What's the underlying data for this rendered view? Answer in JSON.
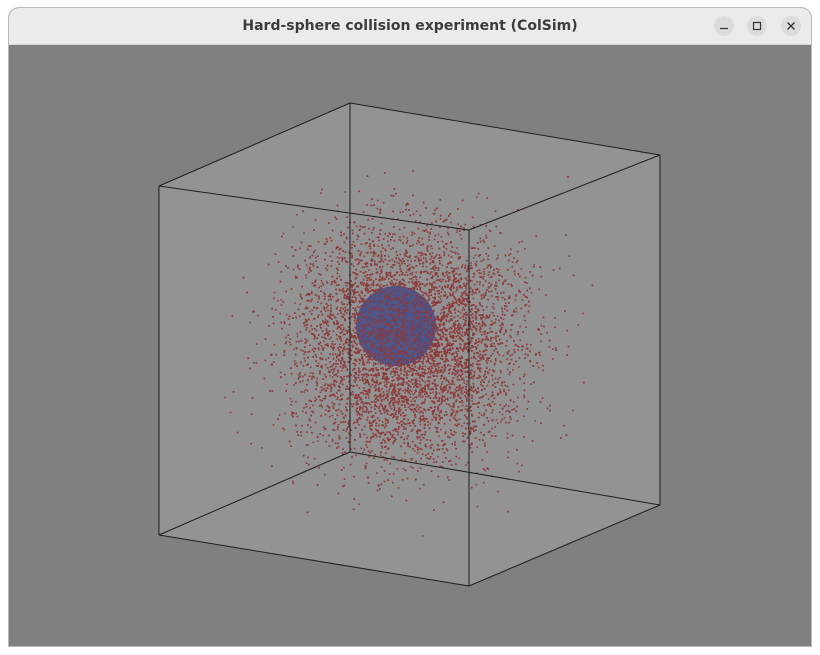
{
  "window": {
    "title": "Hard-sphere collision experiment (ColSim)",
    "controls": [
      "minimize",
      "maximize",
      "close"
    ]
  },
  "scene": {
    "background_color": "#808080",
    "box_face_color": "#939393",
    "edge_color": "#1f1f1f",
    "particle_color": "#8e3a3a",
    "sphere_color": "#4a4f86",
    "particles_shown": true,
    "central_sphere_shown": true
  }
}
